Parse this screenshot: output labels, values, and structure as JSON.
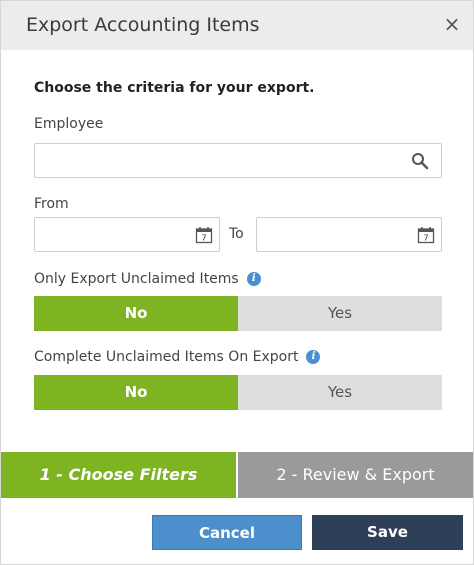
{
  "dialog": {
    "title": "Export Accounting Items",
    "close_glyph": "×"
  },
  "form": {
    "lead": "Choose the criteria for your export.",
    "employee": {
      "label": "Employee",
      "value": "",
      "icon": "search-icon"
    },
    "date_range": {
      "from_label": "From",
      "from_value": "",
      "to_label": "To",
      "to_value": "",
      "icon": "calendar-icon",
      "calendar_day": "7"
    },
    "only_unclaimed": {
      "label": "Only Export Unclaimed Items",
      "options": [
        "No",
        "Yes"
      ],
      "selected": "No"
    },
    "complete_unclaimed": {
      "label": "Complete Unclaimed Items On Export",
      "options": [
        "No",
        "Yes"
      ],
      "selected": "No"
    }
  },
  "steps": [
    {
      "label": "1 - Choose Filters",
      "active": true
    },
    {
      "label": "2 - Review & Export",
      "active": false
    }
  ],
  "buttons": {
    "cancel": "Cancel",
    "save": "Save"
  },
  "colors": {
    "accent_green": "#7eb322",
    "cancel_blue": "#4c8fcd",
    "save_navy": "#2e4057",
    "info_blue": "#4a8fd1"
  }
}
